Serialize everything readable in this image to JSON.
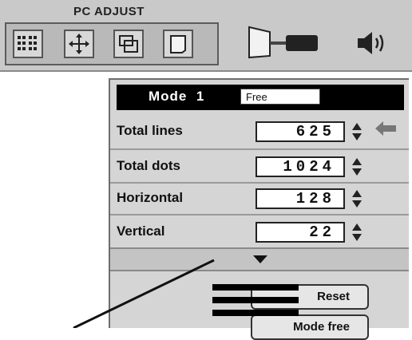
{
  "header": {
    "title": "PC ADJUST",
    "icons": [
      "grid-adjust-icon",
      "move-position-icon",
      "window-resize-icon",
      "screen-icon",
      "projector-icon",
      "speaker-icon"
    ]
  },
  "panel": {
    "mode_label": "Mode",
    "mode_number": "1",
    "mode_value": "Free",
    "rows": [
      {
        "label": "Total lines",
        "value": "625"
      },
      {
        "label": "Total dots",
        "value": "1024"
      },
      {
        "label": "Horizontal",
        "value": "128"
      },
      {
        "label": "Vertical",
        "value": "22"
      }
    ],
    "buttons": {
      "reset": "Reset",
      "mode_free": "Mode free"
    }
  }
}
